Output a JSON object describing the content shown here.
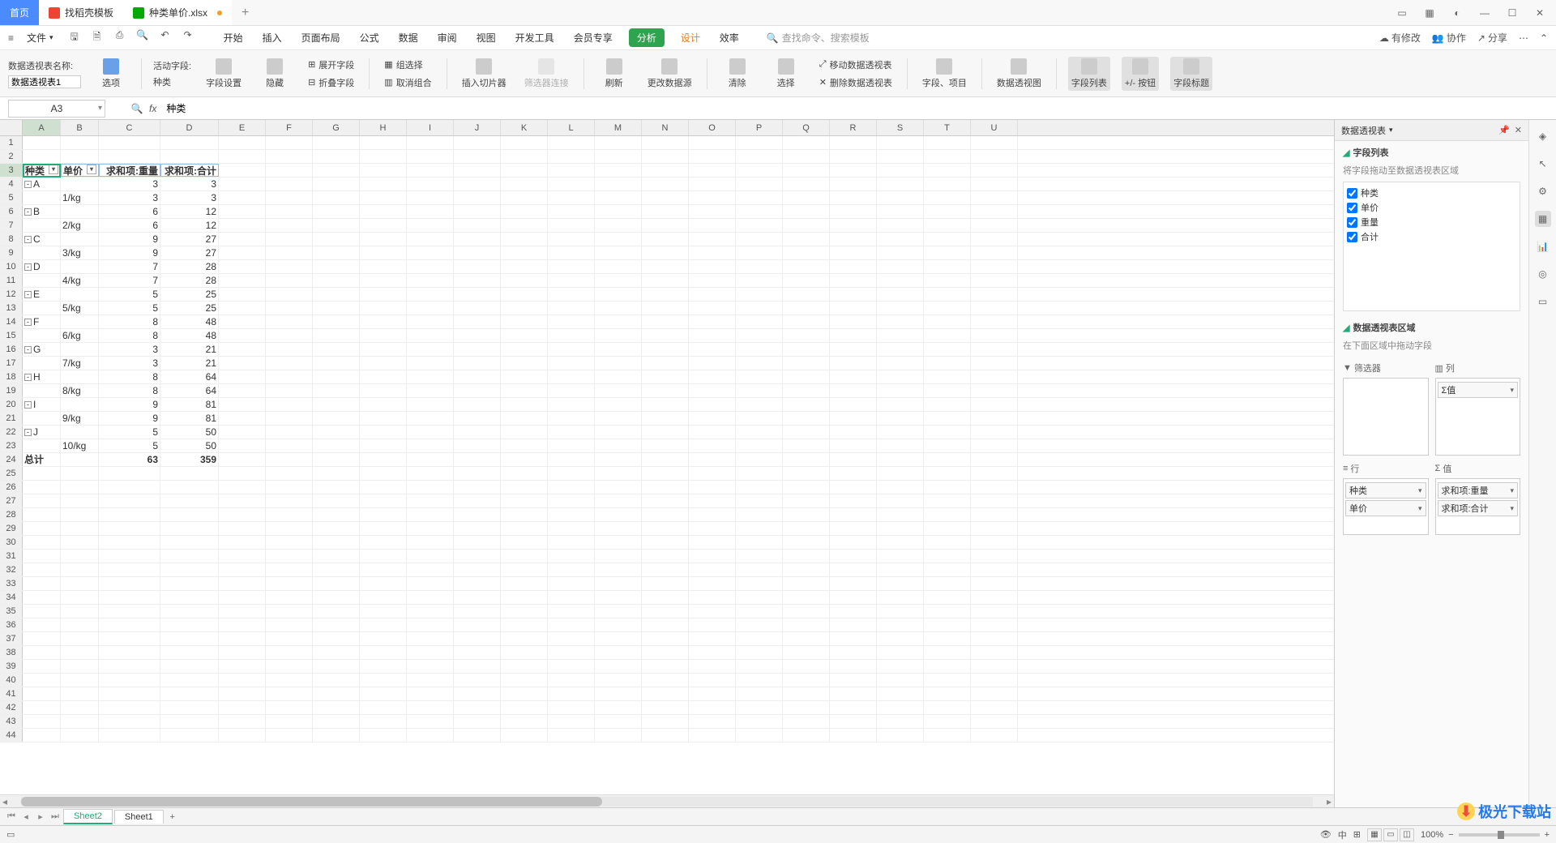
{
  "tabs": {
    "home": "首页",
    "template": "找稻壳模板",
    "file": "种类单价.xlsx"
  },
  "menubar": {
    "file": "文件",
    "menus": [
      "开始",
      "插入",
      "页面布局",
      "公式",
      "数据",
      "审阅",
      "视图",
      "开发工具",
      "会员专享",
      "分析",
      "设计",
      "效率"
    ],
    "search_placeholder": "查找命令、搜索模板",
    "right": {
      "modify": "有修改",
      "collab": "协作",
      "share": "分享"
    }
  },
  "ribbon": {
    "pivot_name_label": "数据透视表名称:",
    "pivot_name_value": "数据透视表1",
    "options": "选项",
    "active_field_label": "活动字段:",
    "active_field_value": "种类",
    "field_settings": "字段设置",
    "hide": "隐藏",
    "expand": "展开字段",
    "collapse": "折叠字段",
    "group_sel": "组选择",
    "ungroup": "取消组合",
    "slicer": "插入切片器",
    "slicer_conn": "筛选器连接",
    "refresh": "刷新",
    "change_src": "更改数据源",
    "clear": "清除",
    "select": "选择",
    "move": "移动数据透视表",
    "delete": "删除数据透视表",
    "fields_items": "字段、项目",
    "chart": "数据透视图",
    "field_list": "字段列表",
    "pm_btn": "+/- 按钮",
    "field_title": "字段标题"
  },
  "namebox": "A3",
  "formula": "种类",
  "columns": [
    "A",
    "B",
    "C",
    "D",
    "E",
    "F",
    "G",
    "H",
    "I",
    "J",
    "K",
    "L",
    "M",
    "N",
    "O",
    "P",
    "Q",
    "R",
    "S",
    "T",
    "U"
  ],
  "pivot_headers": {
    "kind": "种类",
    "price": "单价",
    "sum_weight": "求和项:重量",
    "sum_total": "求和项:合计"
  },
  "chart_data": {
    "type": "table",
    "columns": [
      "种类",
      "单价",
      "求和项:重量",
      "求和项:合计"
    ],
    "rows": [
      {
        "kind": "A",
        "price": "1/kg",
        "weight": 3,
        "total": 3
      },
      {
        "kind": "B",
        "price": "2/kg",
        "weight": 6,
        "total": 12
      },
      {
        "kind": "C",
        "price": "3/kg",
        "weight": 9,
        "total": 27
      },
      {
        "kind": "D",
        "price": "4/kg",
        "weight": 7,
        "total": 28
      },
      {
        "kind": "E",
        "price": "5/kg",
        "weight": 5,
        "total": 25
      },
      {
        "kind": "F",
        "price": "6/kg",
        "weight": 8,
        "total": 48
      },
      {
        "kind": "G",
        "price": "7/kg",
        "weight": 3,
        "total": 21
      },
      {
        "kind": "H",
        "price": "8/kg",
        "weight": 8,
        "total": 64
      },
      {
        "kind": "I",
        "price": "9/kg",
        "weight": 9,
        "total": 81
      },
      {
        "kind": "J",
        "price": "10/kg",
        "weight": 5,
        "total": 50
      }
    ],
    "grand_total": {
      "label": "总计",
      "weight": 63,
      "total": 359
    }
  },
  "pivot_panel": {
    "title": "数据透视表",
    "fields_header": "字段列表",
    "fields_hint": "将字段拖动至数据透视表区域",
    "fields": [
      "种类",
      "单价",
      "重量",
      "合计"
    ],
    "areas_header": "数据透视表区域",
    "areas_hint": "在下面区域中拖动字段",
    "filter": "筛选器",
    "col": "列",
    "row": "行",
    "val": "值",
    "col_items": [
      "Σ值"
    ],
    "row_items": [
      "种类",
      "单价"
    ],
    "val_items": [
      "求和项:重量",
      "求和项:合计"
    ]
  },
  "sheets": {
    "s2": "Sheet2",
    "s1": "Sheet1"
  },
  "status": {
    "zoom": "100%"
  },
  "watermark": "极光下载站"
}
